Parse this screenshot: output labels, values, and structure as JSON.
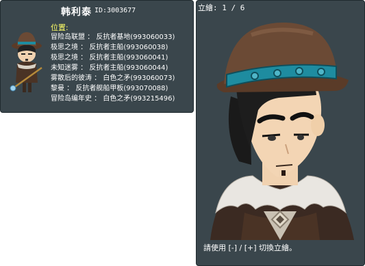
{
  "npc": {
    "name": "韩利泰",
    "id_label": "ID:3003677"
  },
  "location": {
    "title": "位置:",
    "entries": [
      "冒险岛联盟 ： 反抗者基地(993060033)",
      "极思之境 ： 反抗者主船(993060038)",
      "极思之境 ： 反抗者主船(993060041)",
      "未知迷雾 ： 反抗者主船(993060044)",
      "雾散后的彼涛 ： 白色之矛(993060073)",
      "黎曼 ： 反抗者舰船甲板(993070088)",
      "冒险岛编年史 ： 白色之矛(993215496)"
    ]
  },
  "portrait": {
    "counter": "立繪: 1 / 6",
    "hint": "請使用 [-] / [+] 切換立繪。"
  },
  "colors": {
    "panel_bg": "#3a464c",
    "title_yellow": "#ffff66",
    "hat_brown": "#6b4a35",
    "hat_band": "#1e8ca0"
  }
}
